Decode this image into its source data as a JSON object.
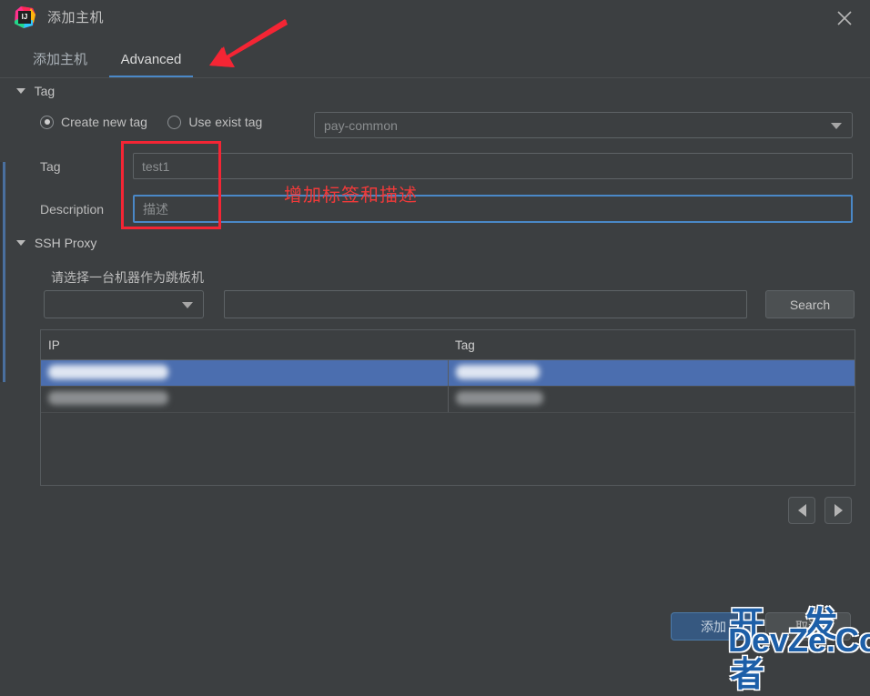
{
  "window": {
    "title": "添加主机",
    "app_icon": "intellij-idea-icon",
    "close_icon": "close-icon"
  },
  "tabs": [
    {
      "label": "添加主机",
      "selected": false
    },
    {
      "label": "Advanced",
      "selected": true
    }
  ],
  "sections": {
    "tag": {
      "title": "Tag",
      "collapse_icon": "chevron-down-icon",
      "radios": [
        {
          "label": "Create new tag",
          "selected": true
        },
        {
          "label": "Use exist tag",
          "selected": false
        }
      ],
      "exist_tag_combo": {
        "value": "pay-common",
        "arrow_icon": "chevron-down-icon"
      },
      "fields": [
        {
          "label": "Tag",
          "value": "test1",
          "focused": false
        },
        {
          "label": "Description",
          "value": "描述",
          "focused": true
        }
      ]
    },
    "ssh_proxy": {
      "title": "SSH Proxy",
      "collapse_icon": "chevron-down-icon",
      "hint": "请选择一台机器作为跳板机",
      "filter_combo": {
        "value": "",
        "arrow_icon": "chevron-down-icon"
      },
      "search_input": {
        "value": "",
        "placeholder": ""
      },
      "search_button": "Search",
      "table": {
        "columns": [
          "IP",
          "Tag"
        ],
        "rows": [
          {
            "ip": "",
            "tag": "",
            "selected": true,
            "redacted": true
          },
          {
            "ip": "",
            "tag": "",
            "selected": false,
            "redacted": true
          }
        ]
      },
      "pager": {
        "prev_icon": "triangle-left-icon",
        "next_icon": "triangle-right-icon"
      }
    }
  },
  "footer": {
    "primary_label": "添加",
    "secondary_label": "取消"
  },
  "annotations": {
    "arrow": "red-arrow-pointing-to-advanced-tab",
    "box": "red-highlight-box-around-tag-and-description",
    "note": "增加标签和描述"
  },
  "watermark": {
    "line1": "开 发 者",
    "line2": "DevZe.CoM"
  },
  "colors": {
    "window_bg": "#3c3f41",
    "accent_blue": "#4a88c7",
    "selection_blue": "#4b6eaf",
    "annotation_red": "#f42534",
    "primary_button": "#365880"
  }
}
